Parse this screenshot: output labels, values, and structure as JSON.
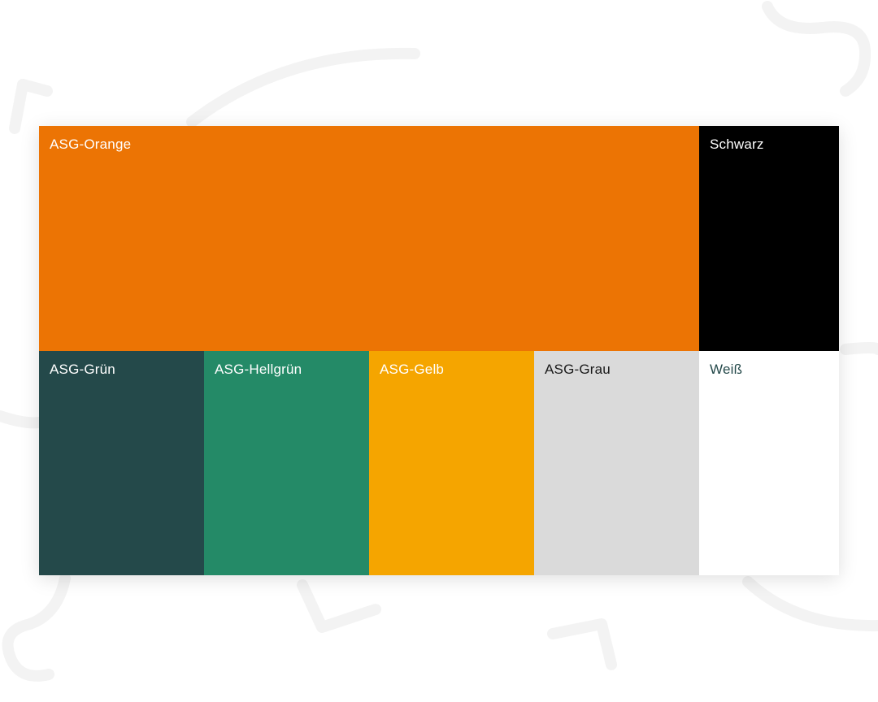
{
  "colors": {
    "background": "#ffffff",
    "decor_stroke": "#f3f3f3"
  },
  "swatches": [
    {
      "id": "orange",
      "label": "ASG-Orange",
      "color": "#ec7404",
      "text_color": "#ffffff"
    },
    {
      "id": "schwarz",
      "label": "Schwarz",
      "color": "#000000",
      "text_color": "#ffffff"
    },
    {
      "id": "gruen",
      "label": "ASG-Grün",
      "color": "#24494a",
      "text_color": "#ffffff"
    },
    {
      "id": "hellgruen",
      "label": "ASG-Hellgrün",
      "color": "#248a67",
      "text_color": "#ffffff"
    },
    {
      "id": "gelb",
      "label": "ASG-Gelb",
      "color": "#f5a500",
      "text_color": "#ffffff"
    },
    {
      "id": "grau",
      "label": "ASG-Grau",
      "color": "#dadada",
      "text_color": "#1a1a1a"
    },
    {
      "id": "weiss",
      "label": "Weiß",
      "color": "#ffffff",
      "text_color": "#24494a"
    }
  ]
}
